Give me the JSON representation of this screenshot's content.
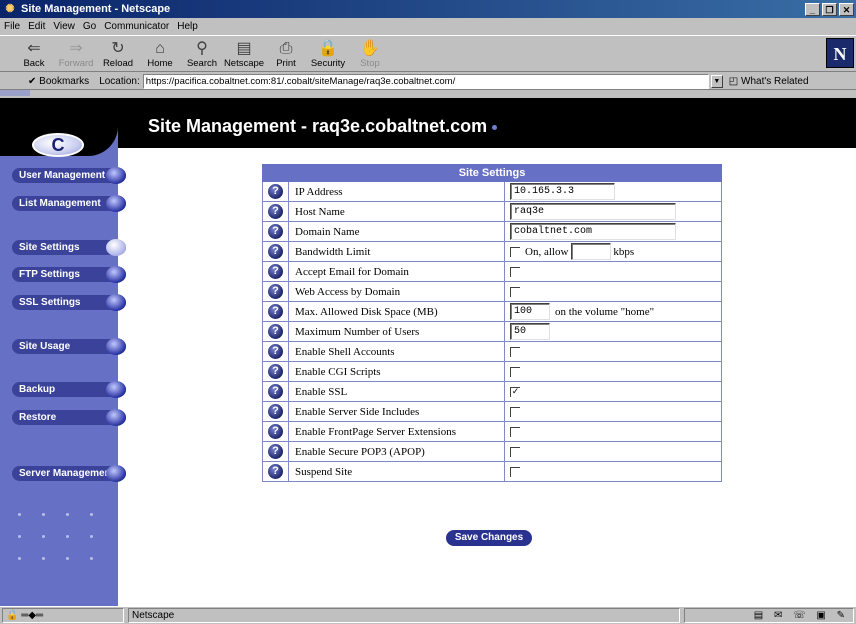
{
  "window": {
    "title": "Site Management - Netscape"
  },
  "menu": [
    "File",
    "Edit",
    "View",
    "Go",
    "Communicator",
    "Help"
  ],
  "toolbar": [
    {
      "label": "Back",
      "icon": "back-arrow-icon",
      "glyph": "⇐",
      "disabled": false
    },
    {
      "label": "Forward",
      "icon": "forward-arrow-icon",
      "glyph": "⇒",
      "disabled": true
    },
    {
      "label": "Reload",
      "icon": "reload-icon",
      "glyph": "↻",
      "disabled": false
    },
    {
      "label": "Home",
      "icon": "home-icon",
      "glyph": "⌂",
      "disabled": false
    },
    {
      "label": "Search",
      "icon": "search-icon",
      "glyph": "⚲",
      "disabled": false
    },
    {
      "label": "Netscape",
      "icon": "netscape-icon",
      "glyph": "▤",
      "disabled": false
    },
    {
      "label": "Print",
      "icon": "print-icon",
      "glyph": "⎙",
      "disabled": false
    },
    {
      "label": "Security",
      "icon": "lock-icon",
      "glyph": "🔒",
      "disabled": false
    },
    {
      "label": "Stop",
      "icon": "stop-icon",
      "glyph": "✋",
      "disabled": true
    }
  ],
  "location": {
    "bookmarks_label": "Bookmarks",
    "location_label": "Location:",
    "url": "https://pacifica.cobaltnet.com:81/.cobalt/siteManage/raq3e.cobaltnet.com/",
    "related_label": "What's Related"
  },
  "page": {
    "heading": "Site Management - raq3e.cobaltnet.com"
  },
  "sidebar": {
    "logo_letter": "C",
    "items": [
      {
        "label": "User Management",
        "active": false
      },
      {
        "label": "List Management",
        "active": false
      },
      {
        "label": "Site Settings",
        "active": true
      },
      {
        "label": "FTP Settings",
        "active": false
      },
      {
        "label": "SSL Settings",
        "active": false
      },
      {
        "label": "Site Usage",
        "active": false
      },
      {
        "label": "Backup",
        "active": false
      },
      {
        "label": "Restore",
        "active": false
      },
      {
        "label": "Server Management",
        "active": false
      }
    ]
  },
  "settings": {
    "title": "Site Settings",
    "help_glyph": "?",
    "rows": [
      {
        "label": "IP Address",
        "type": "text",
        "value": "10.165.3.3",
        "width": 105
      },
      {
        "label": "Host Name",
        "type": "text",
        "value": "raq3e",
        "width": 166
      },
      {
        "label": "Domain Name",
        "type": "text",
        "value": "cobaltnet.com",
        "width": 166
      },
      {
        "label": "Bandwidth Limit",
        "type": "bandwidth",
        "checked": false,
        "prefix": "On, allow",
        "value": "",
        "suffix": "kbps"
      },
      {
        "label": "Accept Email for Domain",
        "type": "checkbox",
        "checked": false
      },
      {
        "label": "Web Access by Domain",
        "type": "checkbox",
        "checked": false
      },
      {
        "label": "Max. Allowed Disk Space (MB)",
        "type": "disk",
        "value": "100",
        "suffix": "on the volume \"home\""
      },
      {
        "label": "Maximum Number of Users",
        "type": "text",
        "value": "50",
        "width": 40
      },
      {
        "label": "Enable Shell Accounts",
        "type": "checkbox",
        "checked": false
      },
      {
        "label": "Enable CGI Scripts",
        "type": "checkbox",
        "checked": false
      },
      {
        "label": "Enable SSL",
        "type": "checkbox",
        "checked": true
      },
      {
        "label": "Enable Server Side Includes",
        "type": "checkbox",
        "checked": false
      },
      {
        "label": "Enable FrontPage Server Extensions",
        "type": "checkbox",
        "checked": false
      },
      {
        "label": "Enable Secure POP3 (APOP)",
        "type": "checkbox",
        "checked": false
      },
      {
        "label": "Suspend Site",
        "type": "checkbox",
        "checked": false
      }
    ],
    "save_label": "Save Changes"
  },
  "status": {
    "text": "Netscape"
  },
  "colors": {
    "sidebar": "#6670c5",
    "nav_button": "#3a429a",
    "banner": "#000000",
    "table_header": "#6670c5"
  }
}
